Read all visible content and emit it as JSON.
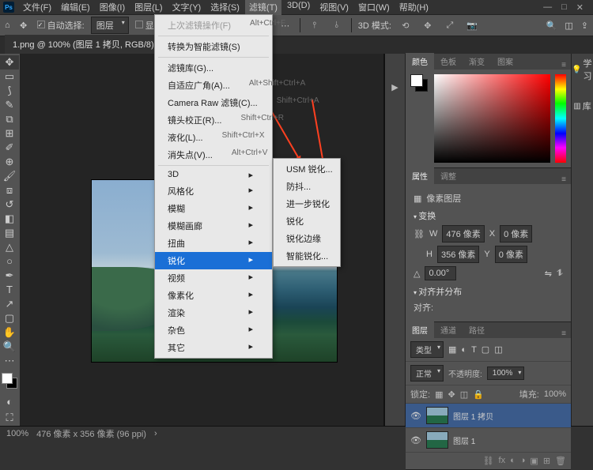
{
  "app": {
    "name": "Ps"
  },
  "menubar": [
    "文件(F)",
    "编辑(E)",
    "图像(I)",
    "图层(L)",
    "文字(Y)",
    "选择(S)",
    "滤镜(T)",
    "3D(D)",
    "视图(V)",
    "窗口(W)",
    "帮助(H)"
  ],
  "menubar_active_index": 6,
  "options": {
    "auto_select_label": "自动选择:",
    "auto_select_value": "图层",
    "show_transform": "显示变换控件",
    "mode_label": "3D 模式:"
  },
  "doc_tab": {
    "title": "1.png @ 100% (图层 1 拷贝, RGB/8)"
  },
  "filter_menu": {
    "last": {
      "label": "上次滤镜操作(F)",
      "shortcut": "Alt+Ctrl+F"
    },
    "smart": "转换为智能滤镜(S)",
    "group1": [
      {
        "label": "滤镜库(G)...",
        "shortcut": ""
      },
      {
        "label": "自适应广角(A)...",
        "shortcut": "Alt+Shift+Ctrl+A"
      },
      {
        "label": "Camera Raw 滤镜(C)...",
        "shortcut": "Shift+Ctrl+A"
      },
      {
        "label": "镜头校正(R)...",
        "shortcut": "Shift+Ctrl+R"
      },
      {
        "label": "液化(L)...",
        "shortcut": "Shift+Ctrl+X"
      },
      {
        "label": "消失点(V)...",
        "shortcut": "Alt+Ctrl+V"
      }
    ],
    "group2": [
      "3D",
      "风格化",
      "模糊",
      "模糊画廊",
      "扭曲",
      "锐化",
      "视频",
      "像素化",
      "渲染",
      "杂色",
      "其它"
    ],
    "highlight_index": 5
  },
  "sharpen_menu": [
    "USM 锐化...",
    "防抖...",
    "进一步锐化",
    "锐化",
    "锐化边缘",
    "智能锐化..."
  ],
  "panels": {
    "color_tabs": [
      "颜色",
      "色板",
      "渐变",
      "图案"
    ],
    "learn": "学习",
    "lib": "库",
    "props_tabs": [
      "属性",
      "调整"
    ],
    "props": {
      "header": "像素图层",
      "transform": "变换",
      "w_label": "W",
      "w_val": "476 像素",
      "h_label": "H",
      "h_val": "356 像素",
      "x_label": "X",
      "x_val": "0 像素",
      "y_label": "Y",
      "y_val": "0 像素",
      "angle": "0.00°",
      "align": "对齐并分布",
      "align_label": "对齐:"
    },
    "layers_tabs": [
      "图层",
      "通道",
      "路径"
    ],
    "layers": {
      "kind": "类型",
      "blend": "正常",
      "opacity_label": "不透明度:",
      "opacity_val": "100%",
      "lock_label": "锁定:",
      "fill_label": "填充:",
      "fill_val": "100%",
      "rows": [
        {
          "name": "图层 1 拷贝"
        },
        {
          "name": "图层 1"
        }
      ]
    }
  },
  "status": {
    "zoom": "100%",
    "info": "476 像素 x 356 像素 (96 ppi)"
  }
}
